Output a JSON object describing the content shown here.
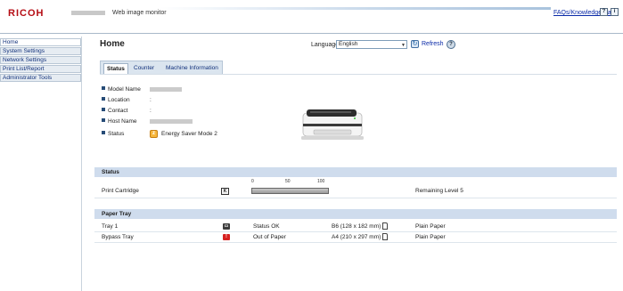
{
  "header": {
    "brand": "RICOH",
    "app_title": "Web image monitor",
    "faq_link": "FAQs/Knowledge Base",
    "help_icon": "question-icon",
    "info_icon": "info-icon"
  },
  "sidebar": {
    "items": [
      {
        "label": "Home"
      },
      {
        "label": "System Settings"
      },
      {
        "label": "Network Settings"
      },
      {
        "label": "Print List/Report"
      },
      {
        "label": "Administrator Tools"
      }
    ]
  },
  "main": {
    "title": "Home",
    "language_label": "Language",
    "language_value": "English",
    "refresh_label": "Refresh",
    "tabs": [
      {
        "label": "Status"
      },
      {
        "label": "Counter"
      },
      {
        "label": "Machine Information"
      }
    ],
    "device_info": {
      "model_name_label": "Model Name",
      "location_label": "Location",
      "location_sep": ":",
      "contact_label": "Contact",
      "contact_sep": ":",
      "host_name_label": "Host Name",
      "status_label": "Status",
      "status_value": "Energy Saver Mode 2"
    },
    "status_section": {
      "title": "Status",
      "scale": [
        "0",
        "50",
        "100"
      ],
      "cartridge_label": "Print Cartridge",
      "cartridge_level_percent": 100,
      "cartridge_remaining": "Remaining Level 5"
    },
    "paper_section": {
      "title": "Paper Tray",
      "trays": [
        {
          "name": "Tray 1",
          "status": "Status OK",
          "size": "B6 (128 x 182 mm)",
          "type": "Plain Paper"
        },
        {
          "name": "Bypass Tray",
          "status": "Out of Paper",
          "size": "A4 (210 x 297 mm)",
          "type": "Plain Paper"
        }
      ]
    }
  },
  "colors": {
    "brand_red": "#b50d14",
    "section_header": "#cfdced",
    "link_blue": "#0a2aa8",
    "error_red": "#d62020"
  }
}
